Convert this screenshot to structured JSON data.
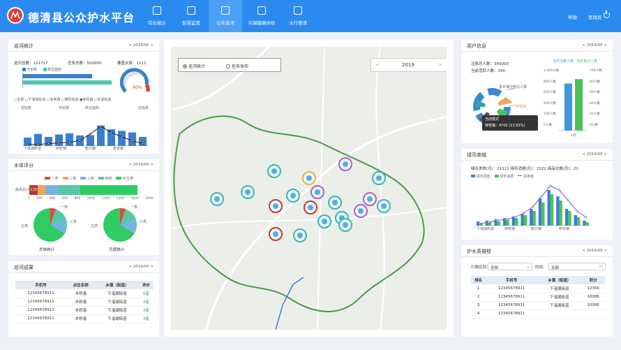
{
  "app": {
    "title": "德清县公众护水平台"
  },
  "nav": [
    {
      "label": "综合展示",
      "icon": "home-icon"
    },
    {
      "label": "智慧监管",
      "icon": "sitemap-icon"
    },
    {
      "label": "公众巡河",
      "icon": "chart-icon"
    },
    {
      "label": "河湖健康体检",
      "icon": "report-icon"
    },
    {
      "label": "水行德清",
      "icon": "document-icon"
    }
  ],
  "header": {
    "help": "帮助",
    "admin": "管理员"
  },
  "patrol_stats": {
    "title": "巡河统计",
    "date": "< 2019/05 >",
    "total_label": "巡河总数：121717",
    "task_label": "任务总数：500000",
    "coverage_label": "覆盖水体：1111",
    "gauge_value": "90%",
    "filters": [
      "全部",
      "下渚湖街道",
      "洛舍镇",
      "舞阳街道",
      "钟管镇",
      "阜溪街道"
    ],
    "legend": [
      "河长数",
      "单位面积"
    ],
    "left_axis": "巡检数",
    "right_axis": "巡检率",
    "x_labels": [
      "下渚湖街道",
      "钟管镇",
      "乾元镇",
      "新安镇"
    ]
  },
  "water_score": {
    "title": "水体评分",
    "date": "< 2019/05 >",
    "legend": [
      "一类",
      "二类",
      "三类",
      "四类",
      "劣五类"
    ],
    "colors": [
      "#e24a3c",
      "#f3a260",
      "#76b3e2",
      "#57c7a6",
      "#2ecc62"
    ],
    "bar_label": "最高总分",
    "bar_value": "120",
    "axis": [
      "0",
      "200",
      "400",
      "600",
      "800",
      "1000",
      "1200",
      "1400",
      "1600",
      "1800"
    ],
    "pie1": "总体统计",
    "pie2": "月度统计",
    "pie_labels": [
      "一类",
      "二类",
      "三类",
      "四类",
      "五类"
    ]
  },
  "patrol_result": {
    "title": "巡河成果",
    "date": "< 2019/05 >",
    "columns": [
      "手机号",
      "点位名称",
      "乡镇（街道）",
      "评价"
    ],
    "rows": [
      [
        "12345678911",
        "木桥港",
        "下渚湖街道",
        "5星"
      ],
      [
        "12345678911",
        "木桥港",
        "下渚湖街道",
        "4星"
      ],
      [
        "12345678911",
        "木桥港",
        "下渚湖街道",
        "3星"
      ],
      [
        "12345678911",
        "木桥港",
        "下渚湖街道",
        "3星"
      ]
    ]
  },
  "map": {
    "tab1": "巡河统计",
    "tab2": "任务发布",
    "year": "2019",
    "prev": "<",
    "next": ">"
  },
  "user_info": {
    "title": "用户信息",
    "date": "< 2019/05 >",
    "total": "注册总人数：340000",
    "active": "当前活跃人数：340",
    "legend": [
      "当月注册人数",
      "当月累计人数"
    ],
    "ring_label": "县乡镇注册总人数",
    "town_label": "钟管镇",
    "tooltip_title": "当前模式",
    "tooltip_value": "钟管镇：4702 (13.83%)",
    "left_axis": [
      "1,000人数",
      "800人数",
      "600人数",
      "400人数",
      "200人数",
      "0人数"
    ],
    "right_axis": [
      "100人数",
      "80人数",
      "60人数",
      "40人数",
      "20人数",
      "0人数"
    ],
    "x_label": "1月"
  },
  "coin_mall": {
    "title": "绿币商城",
    "date": "< 2019/05 >",
    "summary": "绿币发放(月)：11111  绿币消费(月)：2222  商品兑换(月)：22",
    "legend": [
      "绿币发放",
      "绿币消费",
      "兑换率"
    ],
    "x_labels": [
      "下渚湖街道",
      "钟管镇",
      "乾元镇",
      "新安镇"
    ]
  },
  "ranking": {
    "title": "护水英雄榜",
    "date": "< 2019/05 >",
    "district_label": "行政区划：",
    "district_value": "全部",
    "time_label": "时间：",
    "time_value": "全部",
    "columns": [
      "排名",
      "手机号",
      "乡镇（街道）",
      "积分"
    ],
    "rows": [
      [
        "1",
        "12345678911",
        "下渚湖街道",
        "12306"
      ],
      [
        "2",
        "12345678911",
        "下渚湖街道",
        "10086"
      ],
      [
        "3",
        "12345678911",
        "下渚湖街道",
        "10086"
      ],
      [
        "4",
        "12345678911",
        "",
        ""
      ]
    ]
  },
  "chart_data": [
    {
      "type": "bar",
      "title": "",
      "categories": [
        "下渚湖街道",
        "",
        "",
        "钟管镇",
        "",
        "",
        "乾元镇",
        "",
        "",
        "新安镇",
        "",
        ""
      ],
      "series": [
        {
          "name": "河长数",
          "values": [
            28,
            40,
            30,
            38,
            42,
            35,
            36,
            68,
            55,
            50,
            45,
            30
          ]
        },
        {
          "name": "单位面积",
          "values": [
            6,
            5,
            8,
            10,
            12,
            18,
            40,
            65,
            45,
            30,
            18,
            8
          ]
        }
      ],
      "ylim": [
        0,
        120
      ]
    },
    {
      "type": "bar",
      "title": "",
      "categories": [
        "下渚湖街道",
        "",
        "",
        "钟管镇",
        "",
        "",
        "乾元镇",
        "",
        "",
        "新安镇",
        "",
        "",
        ""
      ],
      "series": [
        {
          "name": "绿币发放",
          "values": [
            10,
            12,
            15,
            18,
            22,
            28,
            40,
            65,
            85,
            70,
            40,
            25,
            12
          ]
        },
        {
          "name": "绿币消费",
          "values": [
            5,
            8,
            10,
            14,
            18,
            25,
            35,
            55,
            75,
            60,
            35,
            20,
            8
          ]
        },
        {
          "name": "兑换率",
          "values": [
            5,
            8,
            12,
            15,
            20,
            30,
            45,
            70,
            95,
            85,
            60,
            35,
            20
          ]
        }
      ],
      "ylim": [
        0,
        100
      ]
    },
    {
      "type": "bar",
      "title": "",
      "categories": [
        "1月"
      ],
      "series": [
        {
          "name": "当月注册人数",
          "values": [
            750
          ]
        },
        {
          "name": "当月累计人数",
          "values": [
            82
          ]
        }
      ],
      "ylim": [
        0,
        1000
      ]
    }
  ]
}
